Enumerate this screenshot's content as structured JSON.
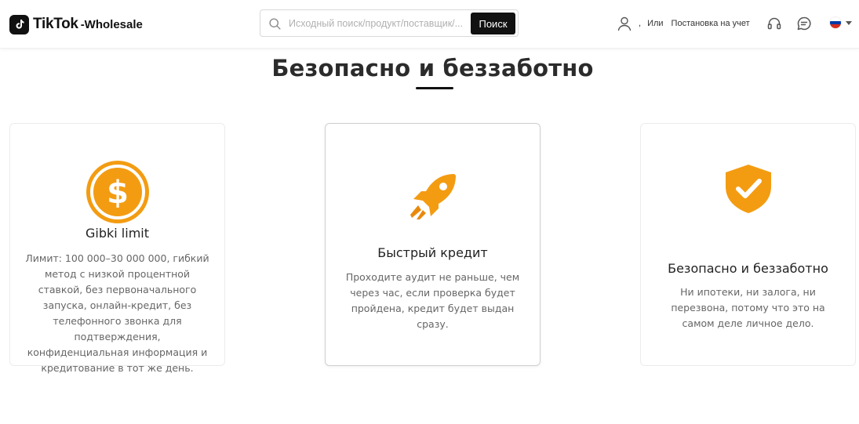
{
  "header": {
    "logo": {
      "brand": "TikTok",
      "suffix": "-Wholesale"
    },
    "search": {
      "placeholder": "Исходный поиск/продукт/поставщик/...",
      "button_label": "Поиск"
    },
    "user": {
      "separator": ",",
      "or_label": "Или",
      "register_label": "Постановка на учет"
    },
    "icons": [
      "user-icon",
      "headset-icon",
      "chat-icon",
      "flag-icon"
    ],
    "language": {
      "flag": "ru",
      "colors": [
        "#ffffff",
        "#0039a6",
        "#d52b1e"
      ]
    }
  },
  "main": {
    "title": "Безопасно и беззаботно",
    "cards": [
      {
        "icon": "dollar-coin-icon",
        "title": "Gibki limit",
        "description": "Лимит: 100 000–30 000 000, гибкий метод с низкой процентной ставкой, без первоначального запуска, онлайн-кредит, без телефонного звонка для подтверждения, конфиденциальная информация и кредитование в тот же день."
      },
      {
        "icon": "rocket-icon",
        "title": "Быстрый кредит",
        "description": "Проходите аудит не раньше, чем через час, если проверка будет пройдена, кредит будет выдан сразу."
      },
      {
        "icon": "shield-check-icon",
        "title": "Безопасно и беззаботно",
        "description": "Ни ипотеки, ни залога, ни перезвона, потому что это на самом деле личное дело."
      }
    ]
  },
  "colors": {
    "accent": "#f39c12",
    "accent_dark": "#e8890c",
    "text": "#222222",
    "muted": "#666666",
    "button": "#111111"
  }
}
